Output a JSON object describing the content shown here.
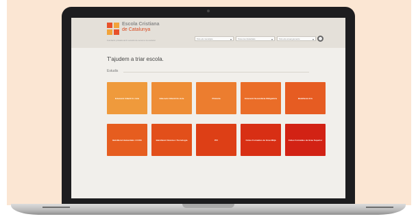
{
  "header": {
    "logo_name": "Escola Cristiana",
    "logo_sub": "de Catalunya",
    "tagline": "Fundació privada amb vocació de servei a la societat",
    "selects": [
      {
        "value": "Tots els municipis"
      },
      {
        "value": "Totes les titularitats"
      },
      {
        "value": "Tots els ensenyaments"
      }
    ]
  },
  "main": {
    "title": "T'ajudem a triar escola.",
    "section": "Estudis",
    "tiles": [
      {
        "label": "Educació Infantil 1r cicle",
        "color": "#ef9a3c"
      },
      {
        "label": "Educació Infantil 2n cicle",
        "color": "#ee8d36"
      },
      {
        "label": "Primària",
        "color": "#ec7d2f"
      },
      {
        "label": "Educació Secundària Obligatòria",
        "color": "#ea6d28"
      },
      {
        "label": "Batxillerat Arts",
        "color": "#e65c22"
      },
      {
        "label": "Batxillerat Humanitats i CCSS",
        "color": "#e65d1f"
      },
      {
        "label": "Batxillerat Ciències i Tecnologia",
        "color": "#e24f1a"
      },
      {
        "label": "PFI",
        "color": "#dd3f16"
      },
      {
        "label": "Cicles Formatius de Grau Mitjà",
        "color": "#d82f14"
      },
      {
        "label": "Cicles Formatius de Grau Superior",
        "color": "#d22214"
      }
    ]
  }
}
